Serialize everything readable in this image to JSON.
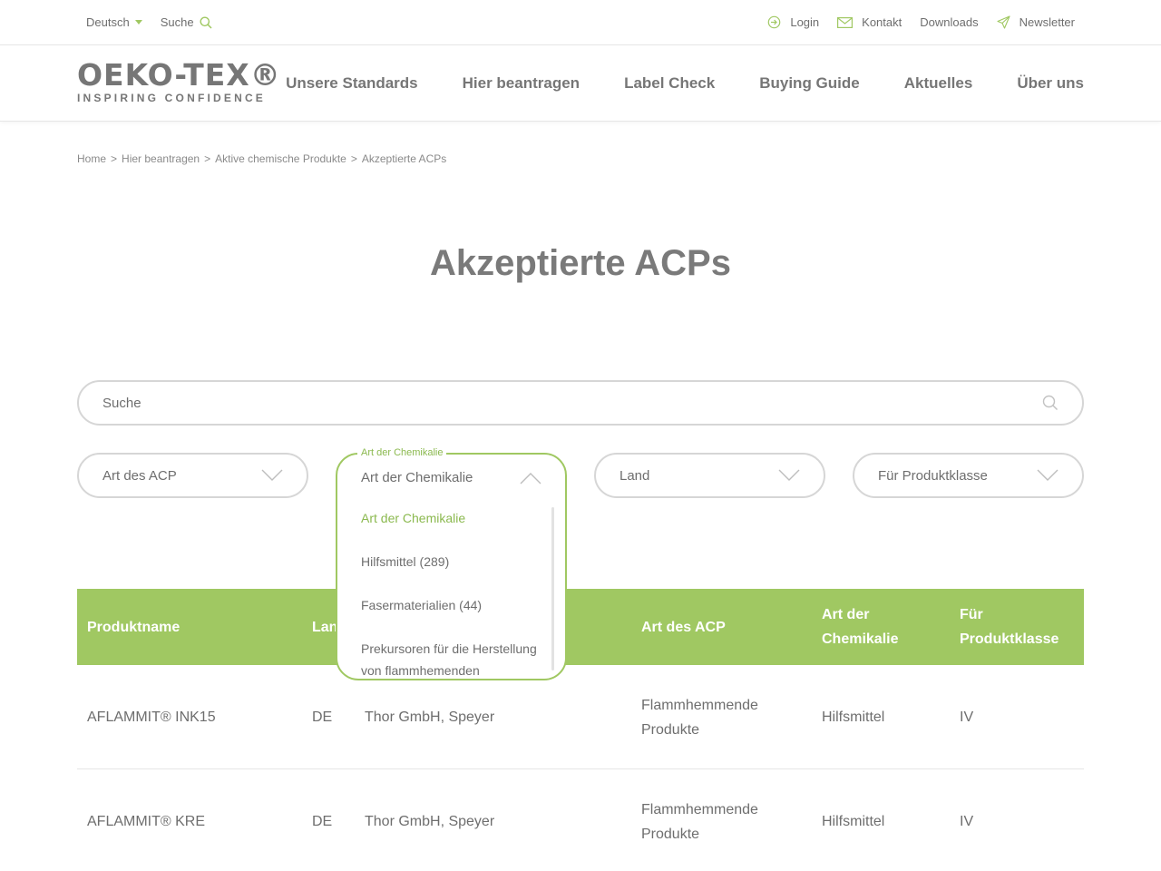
{
  "topbar": {
    "language": "Deutsch",
    "search_label": "Suche",
    "links": [
      {
        "label": "Login",
        "icon": "login-icon"
      },
      {
        "label": "Kontakt",
        "icon": "mail-icon"
      },
      {
        "label": "Downloads",
        "icon": ""
      },
      {
        "label": "Newsletter",
        "icon": "paper-plane-icon"
      }
    ]
  },
  "logo": {
    "brand": "OEKO-TEX®",
    "tagline": "INSPIRING CONFIDENCE"
  },
  "nav": [
    "Unsere Standards",
    "Hier beantragen",
    "Label Check",
    "Buying Guide",
    "Aktuelles",
    "Über uns"
  ],
  "breadcrumb": [
    "Home",
    "Hier beantragen",
    "Aktive chemische Produkte",
    "Akzeptierte ACPs"
  ],
  "page_title": "Akzeptierte ACPs",
  "search": {
    "placeholder": "Suche"
  },
  "filters": {
    "art_des_acp": "Art des ACP",
    "land": "Land",
    "produktklasse": "Für Produktklasse"
  },
  "dropdown": {
    "legend": "Art der Chemikalie",
    "selected": "Art der Chemikalie",
    "options": [
      "Art der Chemikalie",
      "Hilfsmittel (289)",
      "Fasermaterialien (44)",
      "Prekursoren für die Herstellung von flammhemenden"
    ]
  },
  "table": {
    "headers": [
      "Produktname",
      "Lan",
      "",
      "Art des ACP",
      "Art der Chemikalie",
      "Für Produktklasse"
    ],
    "rows": [
      [
        "AFLAMMIT® INK15",
        "DE",
        "Thor GmbH, Speyer",
        "Flammhemmende Produkte",
        "Hilfsmittel",
        "IV"
      ],
      [
        "AFLAMMIT® KRE",
        "DE",
        "Thor GmbH, Speyer",
        "Flammhemmende Produkte",
        "Hilfsmittel",
        "IV"
      ]
    ]
  },
  "colors": {
    "accent": "#a0c862",
    "accent_text": "#8bb94f",
    "text": "#6e6e6e",
    "border": "#d6d6d6"
  }
}
